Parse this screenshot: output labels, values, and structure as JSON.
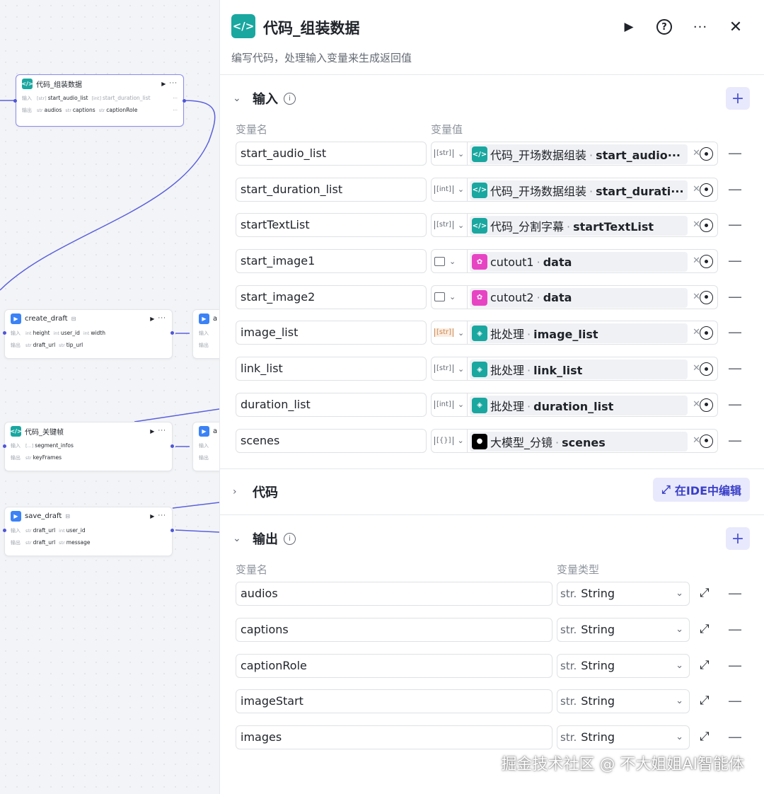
{
  "canvas": {
    "nodes": [
      {
        "id": "code-assemble",
        "icon": "code-icon",
        "title": "代码_组装数据",
        "selected": true,
        "input_label": "输入",
        "output_label": "输出",
        "inputs": [
          {
            "type": "[str]",
            "name": "start_audio_list"
          },
          {
            "type": "[int]",
            "name": "start_duration_list"
          }
        ],
        "outputs": [
          {
            "type": "str",
            "name": "audios"
          },
          {
            "type": "str",
            "name": "captions"
          },
          {
            "type": "str",
            "name": "captionRole"
          }
        ]
      },
      {
        "id": "create-draft",
        "icon": "plugin-icon",
        "title": "create_draft",
        "input_label": "输入",
        "output_label": "输出",
        "inputs": [
          {
            "type": "int",
            "name": "height"
          },
          {
            "type": "int",
            "name": "user_id"
          },
          {
            "type": "int",
            "name": "width"
          }
        ],
        "outputs": [
          {
            "type": "str",
            "name": "draft_url"
          },
          {
            "type": "str",
            "name": "tip_url"
          }
        ]
      },
      {
        "id": "code-keyframes",
        "icon": "code-icon",
        "title": "代码_关键帧",
        "input_label": "输入",
        "output_label": "输出",
        "inputs": [
          {
            "type": "[...]",
            "name": "segment_infos"
          }
        ],
        "outputs": [
          {
            "type": "str",
            "name": "keyFrames"
          }
        ]
      },
      {
        "id": "save-draft",
        "icon": "plugin-icon",
        "title": "save_draft",
        "input_label": "输入",
        "output_label": "输出",
        "inputs": [
          {
            "type": "str",
            "name": "draft_url"
          },
          {
            "type": "int",
            "name": "user_id"
          }
        ],
        "outputs": [
          {
            "type": "str",
            "name": "draft_url"
          },
          {
            "type": "str",
            "name": "message"
          }
        ]
      }
    ],
    "partial_labels": [
      "a",
      "a"
    ]
  },
  "panel": {
    "title": "代码_组装数据",
    "description": "编写代码，处理输入变量来生成返回值",
    "input_section": {
      "title": "输入",
      "col_name": "变量名",
      "col_value": "变量值",
      "rows": [
        {
          "name": "start_audio_list",
          "type": "[str]",
          "src_icon": "code-icon",
          "src_node": "代码_开场数据组装",
          "src_var": "start_audio···"
        },
        {
          "name": "start_duration_list",
          "type": "[int]",
          "src_icon": "code-icon",
          "src_node": "代码_开场数据组装",
          "src_var": "start_durati···"
        },
        {
          "name": "startTextList",
          "type": "[str]",
          "src_icon": "code-icon",
          "src_node": "代码_分割字幕",
          "src_var": "startTextList"
        },
        {
          "name": "start_image1",
          "type": "image",
          "src_icon": "cutout-icon",
          "src_node": "cutout1",
          "src_var": "data"
        },
        {
          "name": "start_image2",
          "type": "image",
          "src_icon": "cutout-icon",
          "src_node": "cutout2",
          "src_var": "data"
        },
        {
          "name": "image_list",
          "type": "[str]",
          "type_warn": true,
          "src_icon": "batch-icon",
          "src_node": "批处理",
          "src_var": "image_list"
        },
        {
          "name": "link_list",
          "type": "[str]",
          "src_icon": "batch-icon",
          "src_node": "批处理",
          "src_var": "link_list"
        },
        {
          "name": "duration_list",
          "type": "[int]",
          "src_icon": "batch-icon",
          "src_node": "批处理",
          "src_var": "duration_list"
        },
        {
          "name": "scenes",
          "type": "[{}]",
          "src_icon": "llm-icon",
          "src_node": "大模型_分镜",
          "src_var": "scenes"
        }
      ]
    },
    "code_section": {
      "title": "代码",
      "ide_button": "在IDE中编辑"
    },
    "output_section": {
      "title": "输出",
      "col_name": "变量名",
      "col_type": "变量类型",
      "rows": [
        {
          "name": "audios",
          "type_prefix": "str.",
          "type": "String"
        },
        {
          "name": "captions",
          "type_prefix": "str.",
          "type": "String"
        },
        {
          "name": "captionRole",
          "type_prefix": "str.",
          "type": "String"
        },
        {
          "name": "imageStart",
          "type_prefix": "str.",
          "type": "String"
        },
        {
          "name": "images",
          "type_prefix": "str.",
          "type": "String"
        }
      ]
    }
  },
  "watermark": "掘金技术社区 @ 不大姐姐AI智能体",
  "colors": {
    "accent": "#4e56d6",
    "code_node": "#19a7a0",
    "plugin_node": "#3b82f6",
    "cutout": "#e744c4"
  }
}
